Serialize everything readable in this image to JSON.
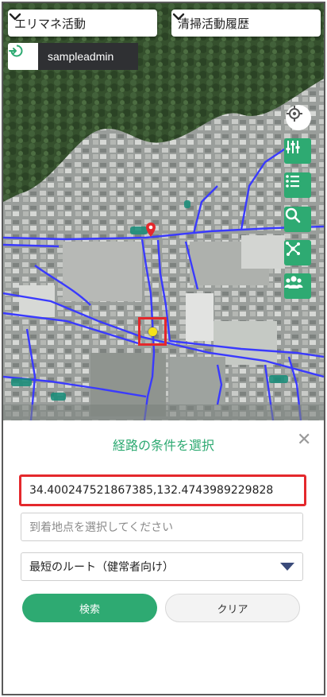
{
  "header": {
    "left_dropdown": "エリマネ活動",
    "right_dropdown": "清掃活動履歴"
  },
  "user": {
    "name": "sampleadmin"
  },
  "side_tools": [
    {
      "icon": "locate-icon"
    },
    {
      "icon": "layers-sliders-icon"
    },
    {
      "icon": "list-icon"
    },
    {
      "icon": "search-icon"
    },
    {
      "icon": "network-icon"
    },
    {
      "icon": "people-icon"
    }
  ],
  "route_panel": {
    "title": "経路の条件を選択",
    "origin_value": "34.400247521867385,132.4743989229828",
    "destination_placeholder": "到着地点を選択してください",
    "route_type": "最短のルート（健常者向け）",
    "search_label": "検索",
    "clear_label": "クリア"
  },
  "colors": {
    "accent": "#2eaa72",
    "highlight": "#e4282c",
    "route_lines": "#3a3aff"
  }
}
